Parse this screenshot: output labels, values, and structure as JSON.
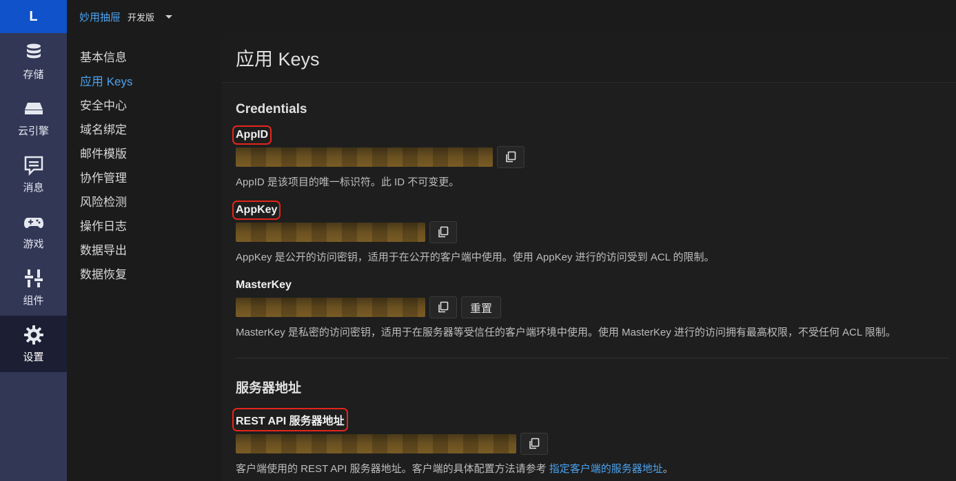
{
  "rail": {
    "logo": "L",
    "items": [
      {
        "label": "存储",
        "icon": "database-icon"
      },
      {
        "label": "云引擎",
        "icon": "server-icon"
      },
      {
        "label": "消息",
        "icon": "message-icon"
      },
      {
        "label": "游戏",
        "icon": "gamepad-icon"
      },
      {
        "label": "组件",
        "icon": "components-icon"
      },
      {
        "label": "设置",
        "icon": "gear-icon",
        "active": true
      }
    ]
  },
  "topbar": {
    "app_name": "妙用抽屉",
    "env": "开发版"
  },
  "subnav": {
    "items": [
      "基本信息",
      "应用 Keys",
      "安全中心",
      "域名绑定",
      "邮件模版",
      "协作管理",
      "风险检测",
      "操作日志",
      "数据导出",
      "数据恢复"
    ],
    "active_index": 1
  },
  "main": {
    "title": "应用 Keys",
    "credentials": {
      "title": "Credentials",
      "appid": {
        "label": "AppID",
        "help": "AppID 是该项目的唯一标识符。此 ID 不可变更。"
      },
      "appkey": {
        "label": "AppKey",
        "help": "AppKey 是公开的访问密钥，适用于在公开的客户端中使用。使用 AppKey 进行的访问受到 ACL 的限制。"
      },
      "masterkey": {
        "label": "MasterKey",
        "reset_label": "重置",
        "help": "MasterKey 是私密的访问密钥，适用于在服务器等受信任的客户端环境中使用。使用 MasterKey 进行的访问拥有最高权限，不受任何 ACL 限制。"
      }
    },
    "server": {
      "title": "服务器地址",
      "rest": {
        "label": "REST API 服务器地址",
        "help_prefix": "客户端使用的 REST API 服务器地址。客户端的具体配置方法请参考",
        "help_link": "指定客户端的服务器地址",
        "help_suffix": "。"
      }
    }
  },
  "colors": {
    "rail_bg": "#323756",
    "logo_bg": "#0f52c9",
    "accent": "#4aa3f0",
    "highlight_box": "#e5251a"
  }
}
